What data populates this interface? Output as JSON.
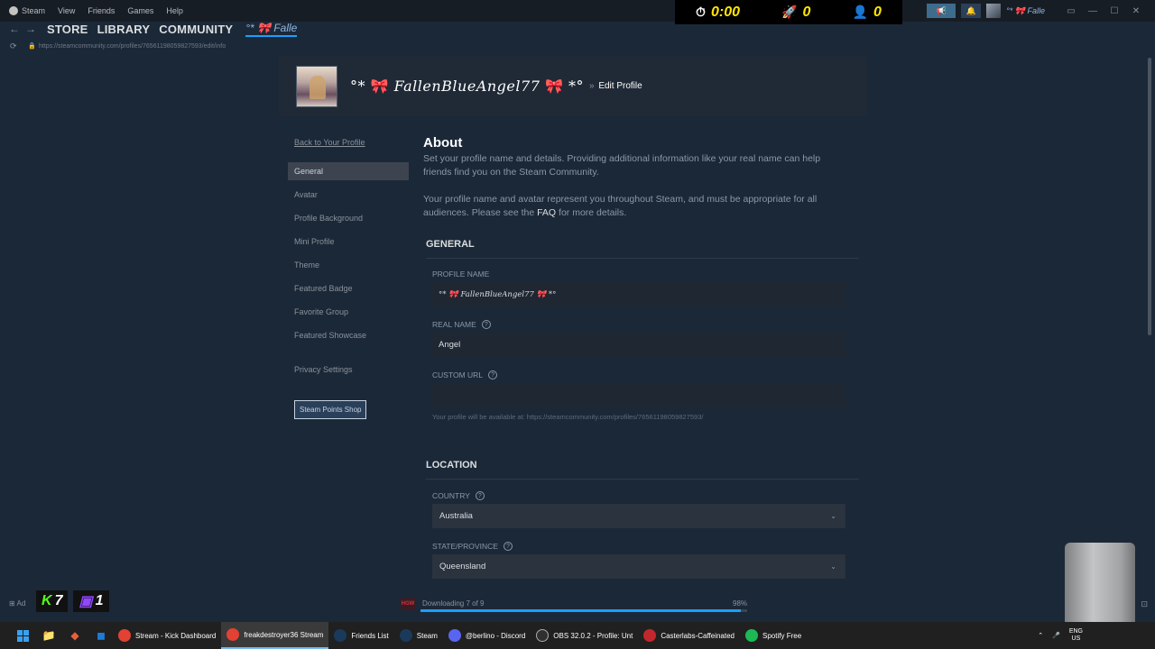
{
  "menubar": {
    "app_label": "Steam",
    "items": [
      "View",
      "Friends",
      "Games",
      "Help"
    ]
  },
  "overlay": {
    "timer": "0:00",
    "rocket_count": "0",
    "user_count": "0"
  },
  "titlebar": {
    "username_short": "°* 🎀 Falle"
  },
  "nav": {
    "store": "STORE",
    "library": "LIBRARY",
    "community": "COMMUNITY",
    "user_tab": "°* 🎀 Falle"
  },
  "url": "https://steamcommunity.com/profiles/76561198059827593/edit/info",
  "profile": {
    "name_prefix": "°*",
    "name": "FallenBlueAngel77",
    "name_suffix": "*°",
    "edit_label": "Edit Profile",
    "separator": "»"
  },
  "sidebar": {
    "back": "Back to Your Profile",
    "items": [
      {
        "label": "General",
        "active": true
      },
      {
        "label": "Avatar"
      },
      {
        "label": "Profile Background"
      },
      {
        "label": "Mini Profile"
      },
      {
        "label": "Theme"
      },
      {
        "label": "Featured Badge"
      },
      {
        "label": "Favorite Group"
      },
      {
        "label": "Featured Showcase"
      }
    ],
    "privacy": "Privacy Settings",
    "points_shop": "Steam Points Shop"
  },
  "about": {
    "title": "About",
    "p1": "Set your profile name and details. Providing additional information like your real name can help friends find you on the Steam Community.",
    "p2_a": "Your profile name and avatar represent you throughout Steam, and must be appropriate for all audiences. Please see the",
    "p2_link": "FAQ",
    "p2_b": "for more details."
  },
  "general": {
    "title": "GENERAL",
    "profile_name_label": "PROFILE NAME",
    "profile_name_value": "°* 🎀 FallenBlueAngel77 🎀 *°",
    "real_name_label": "REAL NAME",
    "real_name_value": "Angel",
    "custom_url_label": "CUSTOM URL",
    "custom_url_value": "",
    "url_hint": "Your profile will be available at: https://steamcommunity.com/profiles/76561198059827593/"
  },
  "location": {
    "title": "LOCATION",
    "country_label": "COUNTRY",
    "country_value": "Australia",
    "state_label": "STATE/PROVINCE",
    "state_value": "Queensland"
  },
  "download": {
    "add_game": "Ad",
    "status": "Downloading 7 of 9",
    "percent": "98%",
    "progress": 0.98,
    "game_icon_text": "HGW"
  },
  "counters": {
    "kick": "7",
    "twitch": "1"
  },
  "taskbar": {
    "apps": [
      {
        "label": "Stream - Kick Dashboard",
        "color": "#e34133"
      },
      {
        "label": "freakdestroyer36 Stream",
        "color": "#e34133",
        "active": true
      },
      {
        "label": "Friends List",
        "color": "#1a3a5c"
      },
      {
        "label": "Steam",
        "color": "#1a3a5c"
      },
      {
        "label": "@berlino - Discord",
        "color": "#5865f2"
      },
      {
        "label": "OBS 32.0.2 - Profile: Unt",
        "color": "#302e31"
      },
      {
        "label": "Casterlabs-Caffeinated",
        "color": "#c0282e"
      },
      {
        "label": "Spotify Free",
        "color": "#1db954"
      }
    ],
    "lang": "ENG",
    "region": "US"
  }
}
